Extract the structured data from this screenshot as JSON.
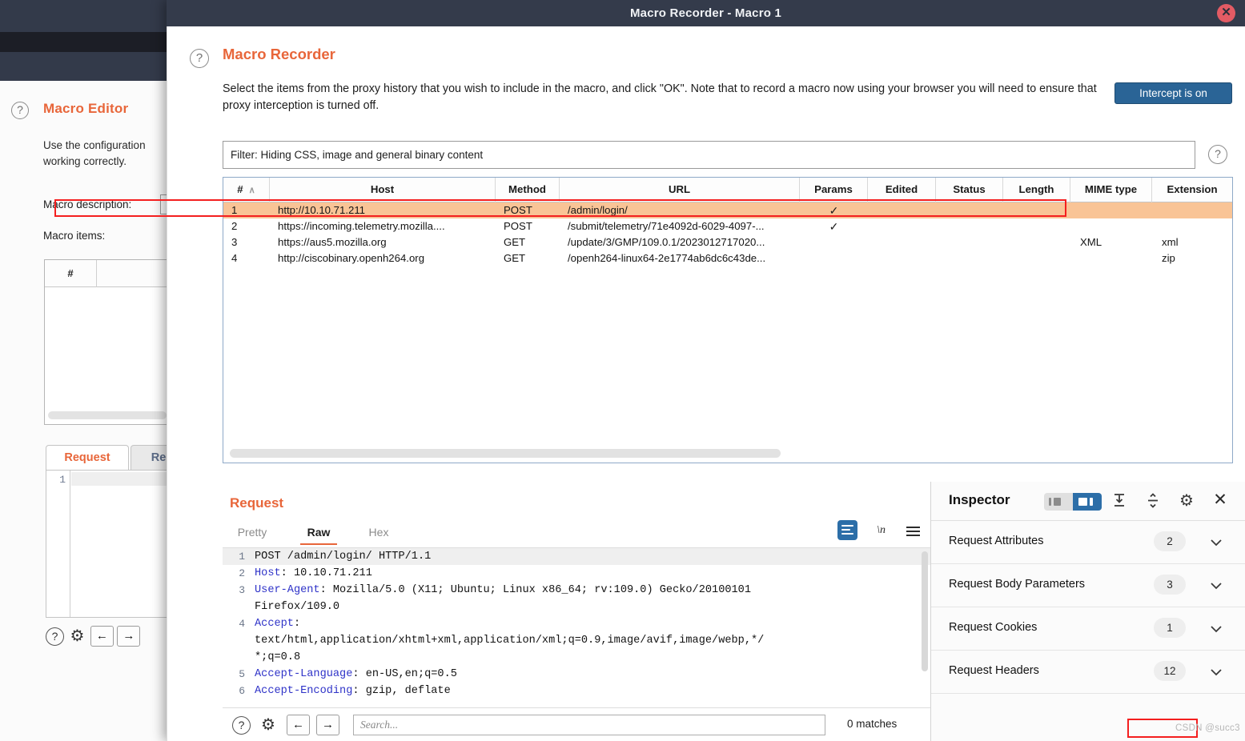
{
  "background_window": {
    "help_icon": "?",
    "title": "Macro Editor",
    "description": "Use the configuration\nworking correctly.",
    "macro_description_label": "Macro description:",
    "macro_items_label": "Macro items:",
    "items_table_header": "#",
    "tabs": [
      {
        "label": "Request",
        "active": true
      },
      {
        "label": "Re",
        "active": false
      }
    ],
    "editor_line_number": "1",
    "footer_icons": [
      "help-icon",
      "gear-icon",
      "back-arrow-icon",
      "forward-arrow-icon"
    ]
  },
  "dialog": {
    "window_title": "Macro Recorder - Macro 1",
    "close_label": "✕",
    "help_icon": "?",
    "heading": "Macro Recorder",
    "description": "Select the items from the proxy history that you wish to include in the macro, and click \"OK\". Note that to record a macro now using your browser you will need to ensure that proxy interception is turned off.",
    "intercept_button": "Intercept is on",
    "filter": {
      "text": "Filter: Hiding CSS, image and general binary content",
      "help_icon": "?"
    }
  },
  "proxy_history": {
    "columns": [
      {
        "label": "#",
        "sort": "∧"
      },
      {
        "label": "Host"
      },
      {
        "label": "Method"
      },
      {
        "label": "URL"
      },
      {
        "label": "Params"
      },
      {
        "label": "Edited"
      },
      {
        "label": "Status"
      },
      {
        "label": "Length"
      },
      {
        "label": "MIME type"
      },
      {
        "label": "Extension"
      }
    ],
    "rows": [
      {
        "num": "1",
        "host": "http://10.10.71.211",
        "method": "POST",
        "url": "/admin/login/",
        "params": "✓",
        "edited": "",
        "status": "",
        "length": "",
        "mime": "",
        "extension": "",
        "selected": true
      },
      {
        "num": "2",
        "host": "https://incoming.telemetry.mozilla....",
        "method": "POST",
        "url": "/submit/telemetry/71e4092d-6029-4097-...",
        "params": "✓",
        "edited": "",
        "status": "",
        "length": "",
        "mime": "",
        "extension": "",
        "selected": false
      },
      {
        "num": "3",
        "host": "https://aus5.mozilla.org",
        "method": "GET",
        "url": "/update/3/GMP/109.0.1/2023012717020...",
        "params": "",
        "edited": "",
        "status": "",
        "length": "",
        "mime": "XML",
        "extension": "xml",
        "selected": false
      },
      {
        "num": "4",
        "host": "http://ciscobinary.openh264.org",
        "method": "GET",
        "url": "/openh264-linux64-2e1774ab6dc6c43de...",
        "params": "",
        "edited": "",
        "status": "",
        "length": "",
        "mime": "",
        "extension": "zip",
        "selected": false
      }
    ]
  },
  "request_panel": {
    "title": "Request",
    "tabs": [
      {
        "label": "Pretty",
        "active": false
      },
      {
        "label": "Raw",
        "active": true
      },
      {
        "label": "Hex",
        "active": false
      }
    ],
    "tools": [
      "word-wrap-icon",
      "newline-icon",
      "menu-icon"
    ],
    "newline_label": "\\n",
    "lines": [
      {
        "n": "1",
        "name": "",
        "rest": "POST /admin/login/ HTTP/1.1",
        "highlight": true
      },
      {
        "n": "2",
        "name": "Host",
        "rest": ": 10.10.71.211"
      },
      {
        "n": "3",
        "name": "User-Agent",
        "rest": ": Mozilla/5.0 (X11; Ubuntu; Linux x86_64; rv:109.0) Gecko/20100101",
        "cont": "Firefox/109.0"
      },
      {
        "n": "4",
        "name": "Accept",
        "rest": ":",
        "cont": "text/html,application/xhtml+xml,application/xml;q=0.9,image/avif,image/webp,*/",
        "cont2": "*;q=0.8"
      },
      {
        "n": "5",
        "name": "Accept-Language",
        "rest": ": en-US,en;q=0.5"
      },
      {
        "n": "6",
        "name": "Accept-Encoding",
        "rest": ": gzip, deflate"
      }
    ],
    "footer": {
      "icons": [
        "help-icon",
        "gear-icon",
        "back-arrow-icon",
        "forward-arrow-icon"
      ],
      "search_placeholder": "Search...",
      "matches": "0 matches"
    }
  },
  "inspector": {
    "title": "Inspector",
    "toolbar_icons": [
      "layout-toggle",
      "collapse-all-icon",
      "expand-all-icon",
      "gear-icon",
      "close-icon"
    ],
    "sections": [
      {
        "label": "Request Attributes",
        "count": "2"
      },
      {
        "label": "Request Body Parameters",
        "count": "3"
      },
      {
        "label": "Request Cookies",
        "count": "1"
      },
      {
        "label": "Request Headers",
        "count": "12"
      }
    ]
  },
  "annotation": {
    "watermark": "CSDN @succ3",
    "highlight_color": "#f41f1f"
  },
  "colors": {
    "accent_orange": "#e8663a",
    "selected_row": "#f9c496",
    "titlebar": "#343b4b",
    "button_blue": "#2a6496",
    "header_name_blue": "#2f33c8"
  }
}
